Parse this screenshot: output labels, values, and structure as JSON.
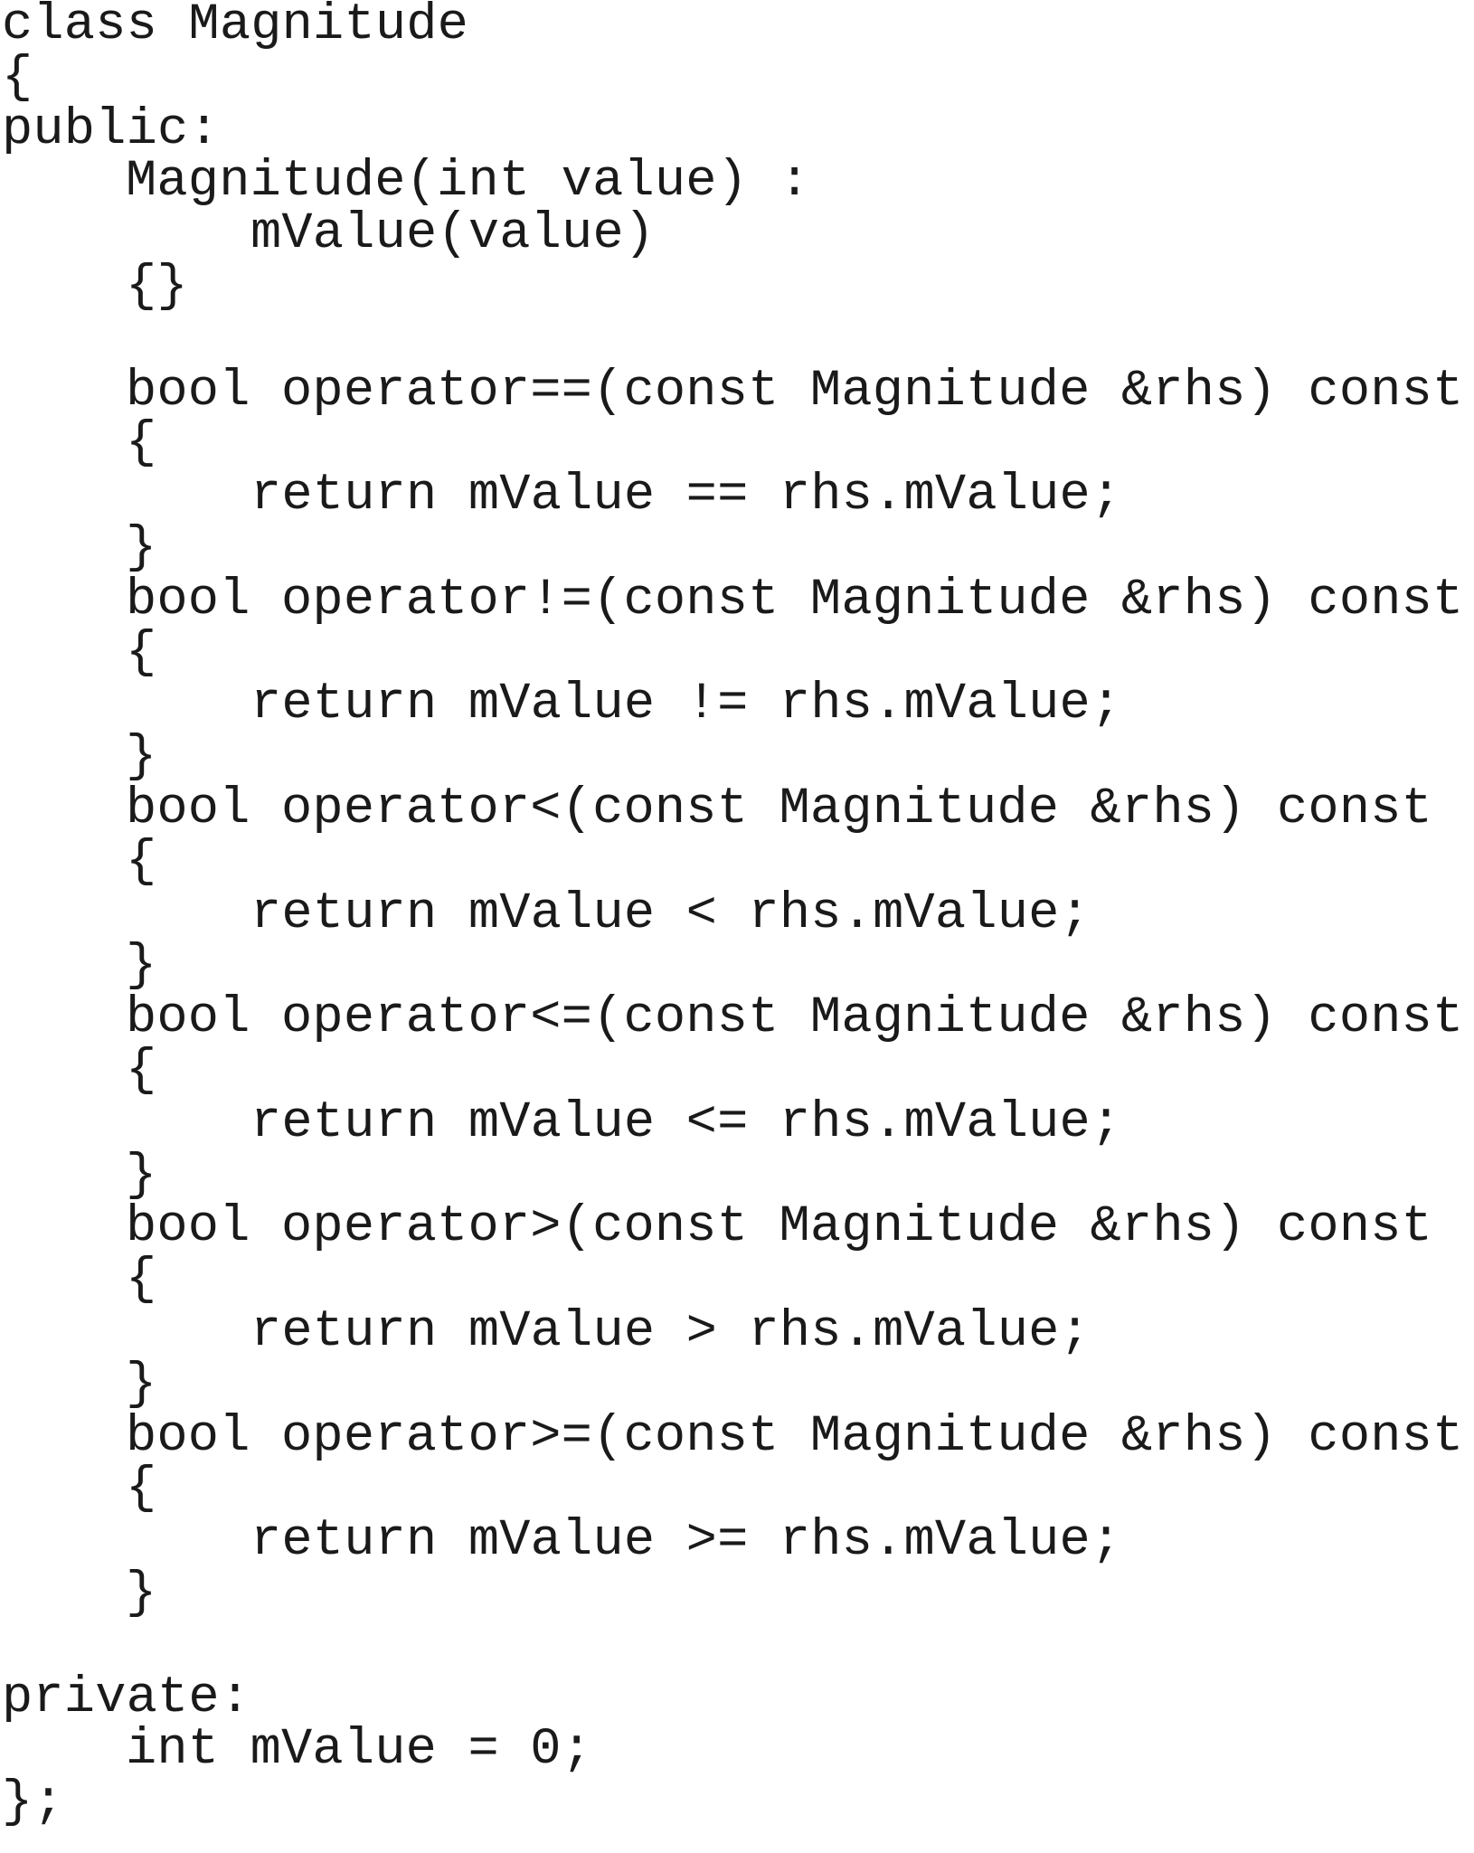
{
  "code": {
    "language": "C++",
    "lines": [
      "class Magnitude",
      "{",
      "public:",
      "Magnitude(int value) :",
      "mValue(value)",
      "{}",
      "",
      "bool operator==(const Magnitude &rhs) const",
      "{",
      "return mValue == rhs.mValue;",
      "}",
      "bool operator!=(const Magnitude &rhs) const",
      "{",
      "return mValue != rhs.mValue;",
      "}",
      "bool operator<(const Magnitude &rhs) const",
      "{",
      "return mValue < rhs.mValue;",
      "}",
      "bool operator<=(const Magnitude &rhs) const",
      "{",
      "return mValue <= rhs.mValue;",
      "}",
      "bool operator>(const Magnitude &rhs) const",
      "{",
      "return mValue > rhs.mValue;",
      "}",
      "bool operator>=(const Magnitude &rhs) const",
      "{",
      "return mValue >= rhs.mValue;",
      "}",
      "",
      "private:",
      "int mValue = 0;",
      "};"
    ]
  }
}
